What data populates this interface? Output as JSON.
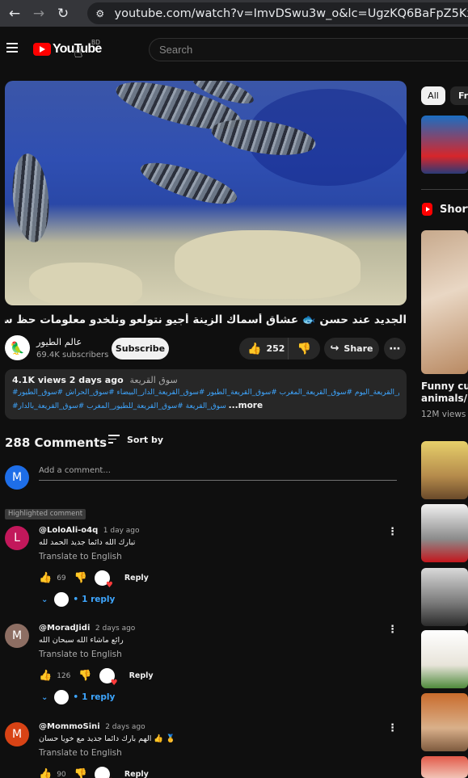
{
  "browser": {
    "url": "youtube.com/watch?v=ImvDSwu3w_o&lc=UgzKQ6BaFpZ5KxpEHQx..."
  },
  "header": {
    "logo_text": "YouTube",
    "country": "BD",
    "search_placeholder": "Search"
  },
  "video": {
    "title": "الجديد عند حسن 🐟 عشاق أسماك الزينة أجيو نتولعو ونلخدو معلومات حظ سعيد للجميع فالمسابقة 🐬",
    "channel_name": "عالم الطيور",
    "subscribers": "69.4K subscribers",
    "subscribe_label": "Subscribe",
    "likes": "252",
    "share_label": "Share",
    "views": "4.1K views",
    "age": "2 days ago",
    "description_tag": "سوق القريعة",
    "hashtags_line1": "#سوق_القريعة_اليوم #سوق_القريعة_المغرب #سوق_القريعة_الطيور #سوق_القريعة_الدار_البيضاء #سوق_الحراش #سوق_الطيور",
    "hashtags_line2": "#سوق_القريعة #سوق_القريعة_للطيور_المغرب #سوق_القريعة_بالدار",
    "more_label": "...more"
  },
  "comments": {
    "count_label": "288 Comments",
    "sort_label": "Sort by",
    "my_avatar_letter": "M",
    "add_placeholder": "Add a comment...",
    "highlight_label": "Highlighted comment",
    "translate_label": "Translate to English",
    "reply_label": "Reply",
    "items": [
      {
        "avatar": "L",
        "color": "#c2185b",
        "handle": "@LoloAli-o4q",
        "time": "1 day ago",
        "text": "تبارك الله دائما جديد الحمد لله",
        "likes": "69",
        "replies": "1 reply"
      },
      {
        "avatar": "M",
        "color": "#8d6e63",
        "handle": "@MoradJidi",
        "time": "2 days ago",
        "text": "رائع ماشاء الله سبحان الله",
        "likes": "126",
        "replies": "1 reply"
      },
      {
        "avatar": "M",
        "color": "#d84315",
        "handle": "@MommoSini",
        "time": "2 days ago",
        "text": "الهم بارك دائما جديد مع خويا حسان 👍 🥇",
        "likes": "90"
      }
    ]
  },
  "sidebar": {
    "chip_all": "All",
    "chip_second": "Fro",
    "shorts_label": "Shorts",
    "short_title_1": "Funny cute",
    "short_title_2": "animals/Pa",
    "short_views": "12M views"
  },
  "colors": {
    "background": "#0f0f0f",
    "surface": "#272727",
    "link": "#3ea6ff",
    "brand_red": "#ff0000"
  }
}
